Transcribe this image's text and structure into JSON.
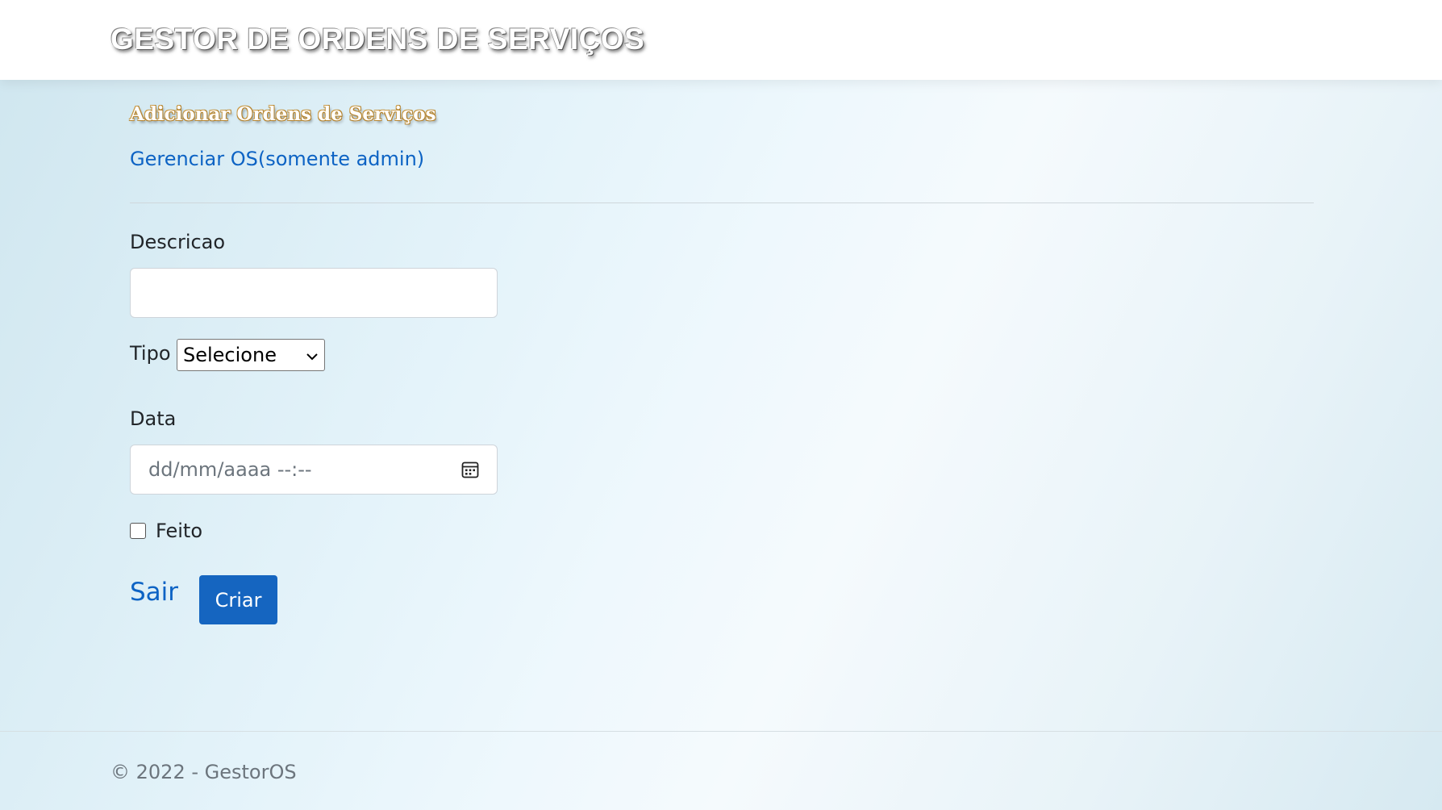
{
  "header": {
    "brand": "GESTOR DE ORDENS DE SERVIÇOS"
  },
  "main": {
    "heading": "Adicionar Ordens de Serviços",
    "manage_link": "Gerenciar OS(somente admin)",
    "form": {
      "descricao_label": "Descricao",
      "descricao_value": "",
      "tipo_label": "Tipo",
      "tipo_selected": "Selecione",
      "data_label": "Data",
      "data_placeholder": "dd/mm/aaaa  --:--",
      "feito_label": "Feito",
      "feito_checked": false,
      "sair_label": "Sair",
      "criar_label": "Criar"
    }
  },
  "footer": {
    "text": "© 2022 - GestorOS"
  },
  "colors": {
    "link": "#0d63c4",
    "primary_button": "#1565c0",
    "heading_outline": "#b5842f"
  },
  "icons": {
    "date_picker": "calendar-icon",
    "select": "chevron-down-icon"
  }
}
